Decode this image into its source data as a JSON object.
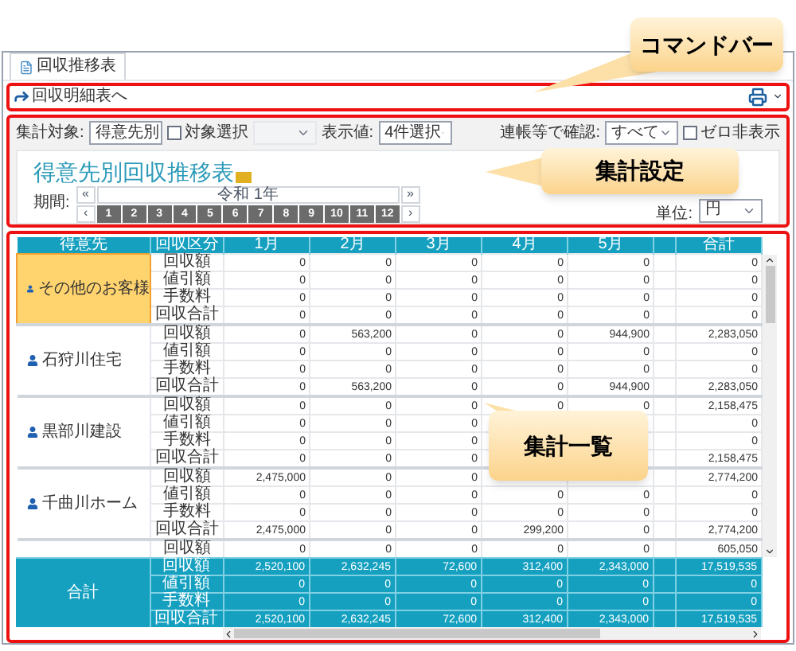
{
  "tab": {
    "label": "回収推移表",
    "selected": true
  },
  "command_bar": {
    "link": "回収明細表へ"
  },
  "filters": [
    {
      "kind": "select",
      "label": "集計対象:",
      "value": "得意先別"
    },
    {
      "kind": "checkbox",
      "label": "対象選択",
      "checked": false
    },
    {
      "kind": "blank_select",
      "disabled": true
    },
    {
      "kind": "select",
      "label": "表示値:",
      "value": "4件選択"
    },
    {
      "kind": "spacer"
    },
    {
      "kind": "select",
      "label": "連帳等で確認:",
      "value": "すべて"
    },
    {
      "kind": "checkbox",
      "label": "ゼロ非表示",
      "checked": false
    }
  ],
  "title": "得意先別回収推移表",
  "period": {
    "label": "期間:",
    "year": "令和 1年",
    "prev_year": "«",
    "next_year": "»",
    "prev": "‹",
    "next": "›",
    "months": [
      {
        "label": "1",
        "selected": true
      },
      {
        "label": "2",
        "selected": true
      },
      {
        "label": "3",
        "selected": true
      },
      {
        "label": "4",
        "selected": true
      },
      {
        "label": "5",
        "selected": true
      },
      {
        "label": "6",
        "selected": true
      },
      {
        "label": "7",
        "selected": true
      },
      {
        "label": "8",
        "selected": true
      },
      {
        "label": "9",
        "selected": true
      },
      {
        "label": "10",
        "selected": true
      },
      {
        "label": "11",
        "selected": true
      },
      {
        "label": "12",
        "selected": true
      }
    ]
  },
  "unit": {
    "label": "単位:",
    "value": "円"
  },
  "table": {
    "columns": [
      "得意先",
      "回収区分",
      "1月",
      "2月",
      "3月",
      "4月",
      "5月",
      "合計"
    ],
    "groups": [
      {
        "customer": "その他のお客様",
        "selected": true,
        "rows": [
          {
            "type": "回収額",
            "values": {
              "m1": "0",
              "m2": "0",
              "m3": "0",
              "m4": "0",
              "m5": "0",
              "total": "0"
            }
          },
          {
            "type": "値引額",
            "values": {
              "m1": "0",
              "m2": "0",
              "m3": "0",
              "m4": "0",
              "m5": "0",
              "total": "0"
            }
          },
          {
            "type": "手数料",
            "values": {
              "m1": "0",
              "m2": "0",
              "m3": "0",
              "m4": "0",
              "m5": "0",
              "total": "0"
            }
          },
          {
            "type": "回収合計",
            "values": {
              "m1": "0",
              "m2": "0",
              "m3": "0",
              "m4": "0",
              "m5": "0",
              "total": "0"
            }
          }
        ]
      },
      {
        "customer": "石狩川住宅",
        "selected": false,
        "rows": [
          {
            "type": "回収額",
            "values": {
              "m1": "0",
              "m2": "563,200",
              "m3": "0",
              "m4": "0",
              "m5": "944,900",
              "total": "2,283,050"
            }
          },
          {
            "type": "値引額",
            "values": {
              "m1": "0",
              "m2": "0",
              "m3": "0",
              "m4": "0",
              "m5": "0",
              "total": "0"
            }
          },
          {
            "type": "手数料",
            "values": {
              "m1": "0",
              "m2": "0",
              "m3": "0",
              "m4": "0",
              "m5": "0",
              "total": "0"
            }
          },
          {
            "type": "回収合計",
            "values": {
              "m1": "0",
              "m2": "563,200",
              "m3": "0",
              "m4": "0",
              "m5": "944,900",
              "total": "2,283,050"
            }
          }
        ]
      },
      {
        "customer": "黒部川建設",
        "selected": false,
        "rows": [
          {
            "type": "回収額",
            "values": {
              "m1": "0",
              "m2": "0",
              "m3": "0",
              "m4": "0",
              "m5": "0",
              "total": "2,158,475"
            }
          },
          {
            "type": "値引額",
            "values": {
              "m1": "0",
              "m2": "0",
              "m3": "0",
              "total": "0"
            }
          },
          {
            "type": "手数料",
            "values": {
              "m1": "0",
              "m2": "0",
              "m3": "0",
              "total": "0"
            }
          },
          {
            "type": "回収合計",
            "values": {
              "m1": "0",
              "m2": "0",
              "m3": "0",
              "total": "2,158,475"
            }
          }
        ]
      },
      {
        "customer": "千曲川ホーム",
        "selected": false,
        "rows": [
          {
            "type": "回収額",
            "values": {
              "m1": "2,475,000",
              "m2": "0",
              "m3": "0",
              "total": "2,774,200"
            }
          },
          {
            "type": "値引額",
            "values": {
              "m1": "0",
              "m2": "0",
              "m3": "0",
              "m4": "0",
              "m5": "0",
              "total": "0"
            }
          },
          {
            "type": "手数料",
            "values": {
              "m1": "0",
              "m2": "0",
              "m3": "0",
              "m4": "0",
              "m5": "0",
              "total": "0"
            }
          },
          {
            "type": "回収合計",
            "values": {
              "m1": "2,475,000",
              "m2": "0",
              "m3": "0",
              "m4": "299,200",
              "m5": "0",
              "total": "2,774,200"
            }
          }
        ]
      },
      {
        "selected": false,
        "rows": [
          {
            "type": "回収額",
            "values": {
              "m1": "0",
              "m2": "0",
              "m3": "0",
              "m4": "0",
              "m5": "0",
              "total": "605,050"
            }
          }
        ]
      }
    ],
    "total": {
      "label": "合計",
      "rows": [
        {
          "type": "回収額",
          "values": {
            "m1": "2,520,100",
            "m2": "2,632,245",
            "m3": "72,600",
            "m4": "312,400",
            "m5": "2,343,000",
            "total": "17,519,535"
          }
        },
        {
          "type": "値引額",
          "values": {
            "m1": "0",
            "m2": "0",
            "m3": "0",
            "m4": "0",
            "m5": "0",
            "total": "0"
          }
        },
        {
          "type": "手数料",
          "values": {
            "m1": "0",
            "m2": "0",
            "m3": "0",
            "m4": "0",
            "m5": "0",
            "total": "0"
          }
        },
        {
          "type": "回収合計",
          "values": {
            "m1": "2,520,100",
            "m2": "2,632,245",
            "m3": "72,600",
            "m4": "312,400",
            "m5": "2,343,000",
            "total": "17,519,535"
          }
        }
      ]
    }
  },
  "callouts": [
    {
      "text": "コマンドバー"
    },
    {
      "text": "集計設定"
    },
    {
      "text": "集計一覧"
    }
  ]
}
